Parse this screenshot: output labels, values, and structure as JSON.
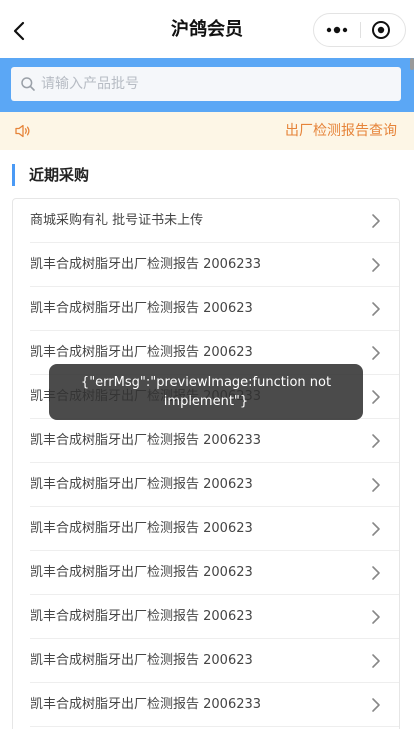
{
  "header": {
    "title": "沪鸽会员",
    "back_icon": "chevron-left-icon",
    "more_icon": "more-dots-icon",
    "close_icon": "target-circle-icon"
  },
  "search": {
    "placeholder": "请输入产品批号",
    "value": "",
    "icon": "search-icon"
  },
  "notice": {
    "icon": "speaker-icon",
    "link_label": "出厂检测报告查询"
  },
  "section": {
    "title": "近期采购"
  },
  "list": {
    "items": [
      {
        "label": "商城采购有礼 批号证书未上传"
      },
      {
        "label": "凯丰合成树脂牙出厂检测报告 2006233"
      },
      {
        "label": "凯丰合成树脂牙出厂检测报告 200623"
      },
      {
        "label": "凯丰合成树脂牙出厂检测报告 200623"
      },
      {
        "label": "凯丰合成树脂牙出厂检测报告 2006233"
      },
      {
        "label": "凯丰合成树脂牙出厂检测报告 2006233"
      },
      {
        "label": "凯丰合成树脂牙出厂检测报告 200623"
      },
      {
        "label": "凯丰合成树脂牙出厂检测报告 200623"
      },
      {
        "label": "凯丰合成树脂牙出厂检测报告 200623"
      },
      {
        "label": "凯丰合成树脂牙出厂检测报告 200623"
      },
      {
        "label": "凯丰合成树脂牙出厂检测报告 200623"
      },
      {
        "label": "凯丰合成树脂牙出厂检测报告 2006233"
      }
    ]
  },
  "toast": {
    "message": "{\"errMsg\":\"previewImage:function not implement\"}"
  },
  "colors": {
    "accent": "#5ba7f5",
    "notice_bg": "#fdf6e6",
    "notice_text": "#e6843a",
    "section_bar": "#4a9af5"
  }
}
